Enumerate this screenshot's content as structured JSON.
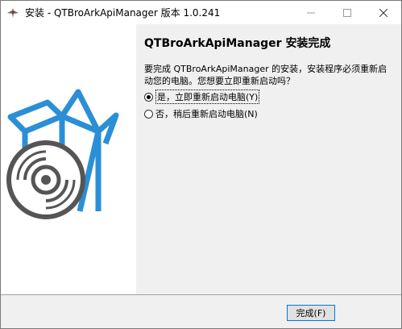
{
  "window": {
    "title": "安装 - QTBroArkApiManager 版本 1.0.241"
  },
  "caption_buttons": {
    "minimize": "—",
    "maximize": "☐",
    "close": "✕"
  },
  "content": {
    "heading": "QTBroArkApiManager 安装完成",
    "description": "要完成 QTBroArkApiManager 的安装，安装程序必须重新启动您的电脑。您想要立即重新启动吗？",
    "options": [
      {
        "label": "是，立即重新启动电脑(Y)",
        "selected": true
      },
      {
        "label": "否，稍后重新启动电脑(N)",
        "selected": false
      }
    ]
  },
  "footer": {
    "finish_label": "完成(F)"
  },
  "colors": {
    "accent_blue": "#2b8fd6",
    "panel_bg": "#f0f0f0",
    "focus_border": "#0078d7"
  }
}
